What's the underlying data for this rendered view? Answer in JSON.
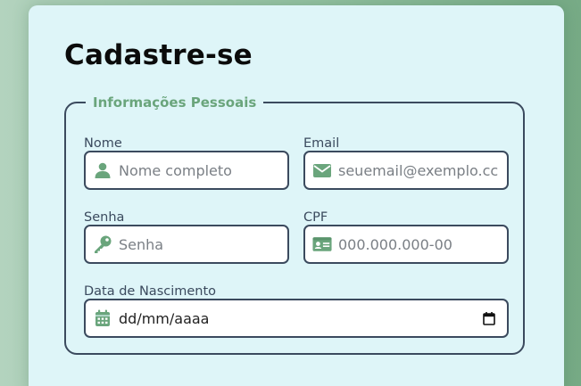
{
  "form": {
    "title": "Cadastre-se",
    "section_legend": "Informações Pessoais",
    "fields": {
      "nome": {
        "label": "Nome",
        "placeholder": "Nome completo",
        "icon": "user-icon"
      },
      "email": {
        "label": "Email",
        "placeholder": "seuemail@exemplo.cc",
        "icon": "envelope-icon"
      },
      "senha": {
        "label": "Senha",
        "placeholder": "Senha",
        "icon": "key-icon"
      },
      "cpf": {
        "label": "CPF",
        "placeholder": "000.000.000-00",
        "icon": "id-card-icon"
      },
      "nascimento": {
        "label": "Data de Nascimento",
        "value": "dd/mm/aaaa",
        "icon": "calendar-icon"
      }
    }
  },
  "colors": {
    "accent": "#6aa57c",
    "border": "#3b4a5e",
    "card_background": "#def5f8"
  }
}
